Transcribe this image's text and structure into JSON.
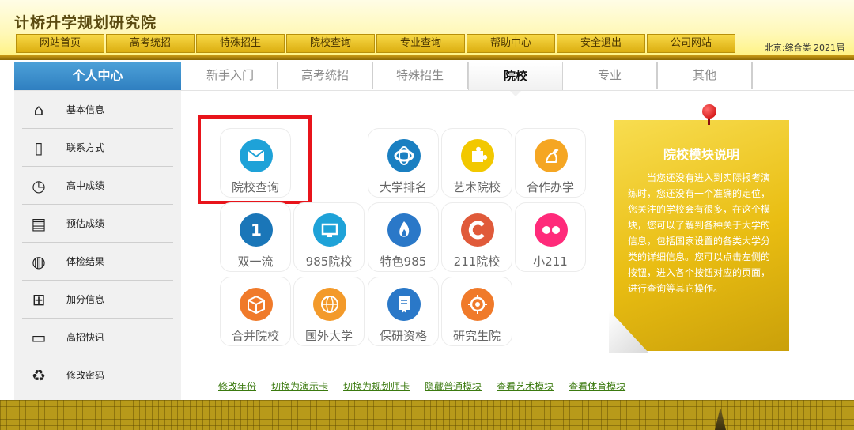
{
  "header": {
    "site_title": "计桥升学规划研究院",
    "region": "北京:综合类 2021届",
    "nav": [
      "网站首页",
      "高考统招",
      "特殊招生",
      "院校查询",
      "专业查询",
      "帮助中心",
      "安全退出",
      "公司网站"
    ]
  },
  "sidebar": {
    "title": "个人中心",
    "items": [
      {
        "label": "基本信息",
        "icon": "home-icon"
      },
      {
        "label": "联系方式",
        "icon": "phone-icon"
      },
      {
        "label": "高中成绩",
        "icon": "clock-icon"
      },
      {
        "label": "预估成绩",
        "icon": "notebook-icon"
      },
      {
        "label": "体检结果",
        "icon": "globe-icon"
      },
      {
        "label": "加分信息",
        "icon": "gift-icon"
      },
      {
        "label": "高招快讯",
        "icon": "laptop-icon"
      },
      {
        "label": "修改密码",
        "icon": "recycle-icon"
      }
    ]
  },
  "tabs": [
    {
      "label": "新手入门",
      "active": false
    },
    {
      "label": "高考统招",
      "active": false
    },
    {
      "label": "特殊招生",
      "active": false
    },
    {
      "label": "院校",
      "active": true
    },
    {
      "label": "专业",
      "active": false
    },
    {
      "label": "其他",
      "active": false
    }
  ],
  "modules": [
    {
      "label": "院校查询",
      "icon": "mail-icon",
      "color": "#1ea2d8"
    },
    {
      "label": "大学排名",
      "icon": "globe-swirl-icon",
      "color": "#1a7fc1"
    },
    {
      "label": "艺术院校",
      "icon": "puzzle-icon",
      "color": "#f2c800"
    },
    {
      "label": "合作办学",
      "icon": "kangaroo-icon",
      "color": "#f5a623"
    },
    {
      "label": "双一流",
      "glyph": "1",
      "icon": "number-one-icon",
      "color": "#1a76b8"
    },
    {
      "label": "985院校",
      "icon": "monitor-icon",
      "color": "#1ea2d8"
    },
    {
      "label": "特色985",
      "icon": "flame-icon",
      "color": "#2a78c8"
    },
    {
      "label": "211院校",
      "icon": "c-logo-icon",
      "color": "#e05a3a"
    },
    {
      "label": "小211",
      "icon": "dots-icon",
      "color": "#ff2a7a"
    },
    {
      "label": "合并院校",
      "icon": "cube-icon",
      "color": "#f07a2a"
    },
    {
      "label": "国外大学",
      "icon": "world-icon",
      "color": "#f39a2a"
    },
    {
      "label": "保研资格",
      "icon": "document-icon",
      "color": "#2a78c8"
    },
    {
      "label": "研究生院",
      "icon": "target-icon",
      "color": "#f07a2a"
    }
  ],
  "note": {
    "title": "院校模块说明",
    "body": "当您还没有进入到实际报考演练时，您还没有一个准确的定位，您关注的学校会有很多，在这个模块，您可以了解到各种关于大学的信息，包括国家设置的各类大学分类的详细信息。您可以点击左侧的按钮，进入各个按钮对应的页面，进行查询等其它操作。"
  },
  "bottom_links": [
    "修改年份",
    "切换为演示卡",
    "切换为规划师卡",
    "隐藏普通模块",
    "查看艺术模块",
    "查看体育模块"
  ]
}
